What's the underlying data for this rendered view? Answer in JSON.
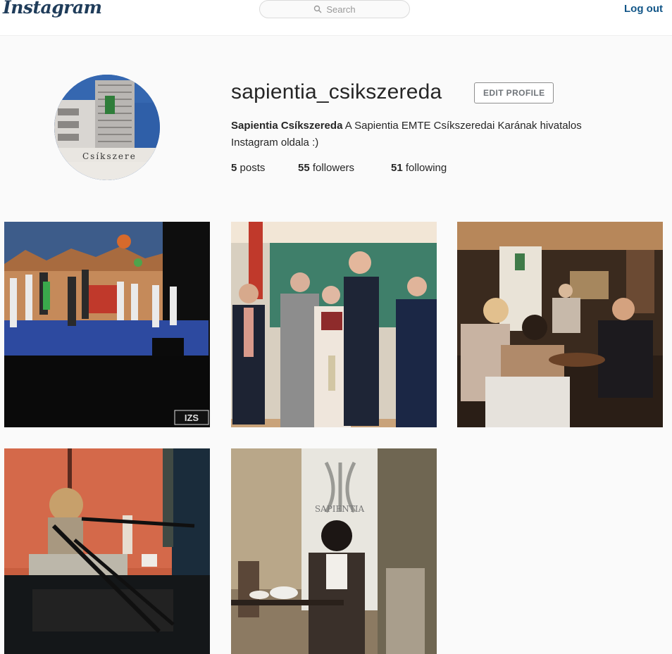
{
  "header": {
    "logo": "Instagram",
    "search_placeholder": "Search",
    "logout_label": "Log out"
  },
  "profile": {
    "username": "sapientia_csikszereda",
    "edit_profile_label": "EDIT PROFILE",
    "full_name": "Sapientia Csíkszereda",
    "bio": "A Sapientia EMTE Csíkszeredai Karának hivatalos Instagram oldala :)",
    "avatar_sign_text": "Csíkszere",
    "stats": {
      "posts_count": "5",
      "posts_label": "posts",
      "followers_count": "55",
      "followers_label": "followers",
      "following_count": "51",
      "following_label": "following"
    }
  },
  "posts": [
    {
      "watermark": "IZS"
    },
    {},
    {},
    {},
    {
      "sign_text": "SAPIENTIA"
    }
  ],
  "colors": {
    "link_blue": "#125688",
    "logo_navy": "#1f3c5a",
    "background": "#fafafa"
  }
}
